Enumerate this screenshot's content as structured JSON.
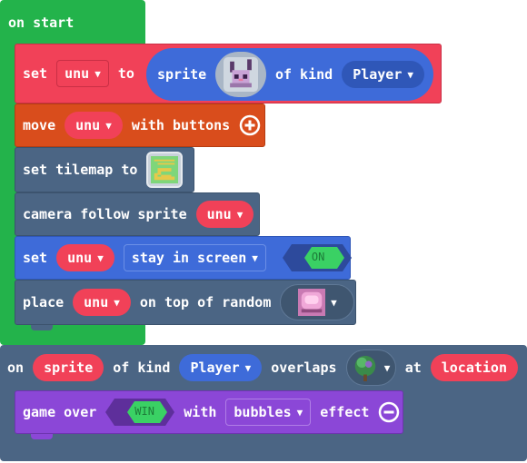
{
  "on_start": {
    "hat_label": "on start",
    "set_sprite": {
      "set_label": "set",
      "var_name": "unu",
      "to_label": "to",
      "sprite_label": "sprite",
      "of_kind_label": "of kind",
      "kind_value": "Player",
      "sprite_image": "bunny-sprite-icon"
    },
    "move": {
      "move_label": "move",
      "var_name": "unu",
      "with_buttons_label": "with buttons",
      "expand_icon": "plus-circle-icon"
    },
    "set_tilemap": {
      "label": "set tilemap to",
      "tilemap_image": "maze-tilemap-icon"
    },
    "camera": {
      "label": "camera follow sprite",
      "var_name": "unu"
    },
    "stay_in_screen": {
      "set_label": "set",
      "var_name": "unu",
      "flag_value": "stay in screen",
      "toggle_label": "ON"
    },
    "place": {
      "place_label": "place",
      "var_name": "unu",
      "on_top_label": "on top of random",
      "tile_image": "pink-tile-icon"
    }
  },
  "overlap": {
    "on_label": "on",
    "sprite_label": "sprite",
    "of_kind_label": "of kind",
    "kind_value": "Player",
    "overlaps_label": "overlaps",
    "tile_image": "tree-tile-icon",
    "at_label": "at",
    "location_label": "location",
    "game_over": {
      "label": "game over",
      "toggle_label": "WIN",
      "with_label": "with",
      "effect_value": "bubbles",
      "effect_label": "effect",
      "collapse_icon": "minus-circle-icon"
    }
  },
  "colors": {
    "events_green": "#23b34b",
    "sprites_red": "#f14158",
    "controller_orange": "#d94d1c",
    "scene_slate": "#4b6584",
    "sprites_blue": "#3e6bd9",
    "game_purple": "#8b47d7",
    "toggle_green": "#3ad164"
  }
}
